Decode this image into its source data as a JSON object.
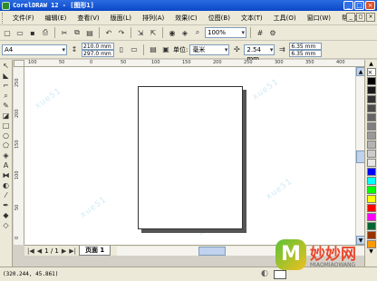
{
  "window": {
    "title": "CorelDRAW 12 - [图形1]"
  },
  "menu": [
    "文件(F)",
    "编辑(E)",
    "查看(V)",
    "版面(L)",
    "排列(A)",
    "效果(C)",
    "位图(B)",
    "文本(T)",
    "工具(O)",
    "窗口(W)",
    "帮助(H)"
  ],
  "toolbar": {
    "zoom": "100%"
  },
  "propertybar": {
    "paper_size": "A4",
    "width": "210.0 mm",
    "height": "297.0 mm",
    "unit_label": "单位:",
    "unit": "毫米",
    "nudge": "2.54 mm",
    "dup_x": "6.35 mm",
    "dup_y": "6.35 mm"
  },
  "rulers": {
    "horizontal_ticks": [
      "100",
      "50",
      "0",
      "50",
      "100",
      "150",
      "200",
      "250",
      "300",
      "350",
      "400"
    ],
    "vertical_ticks": [
      "250",
      "200",
      "150",
      "100",
      "50",
      "0"
    ]
  },
  "pagebar": {
    "page_count": "1 / 1",
    "page_tab": "页面 1"
  },
  "status": {
    "coords": "(320.244, 45.861)"
  },
  "palette": [
    "#ffffff",
    "#000000",
    "#1a1a1a",
    "#333333",
    "#4d4d4d",
    "#666666",
    "#808080",
    "#999999",
    "#b3b3b3",
    "#cccccc",
    "#e6e6e6",
    "#0000ff",
    "#00ffff",
    "#00ff00",
    "#ffff00",
    "#ff0000",
    "#ff00ff",
    "#006633",
    "#993300",
    "#ff9900"
  ],
  "watermark": [
    "xue51",
    "xue51",
    "xue51",
    "xue51",
    "xue51",
    "xue51"
  ],
  "logo": {
    "brand": "妙妙网",
    "brand_en": "MIAOMIAOWANG",
    "badge": "M"
  }
}
